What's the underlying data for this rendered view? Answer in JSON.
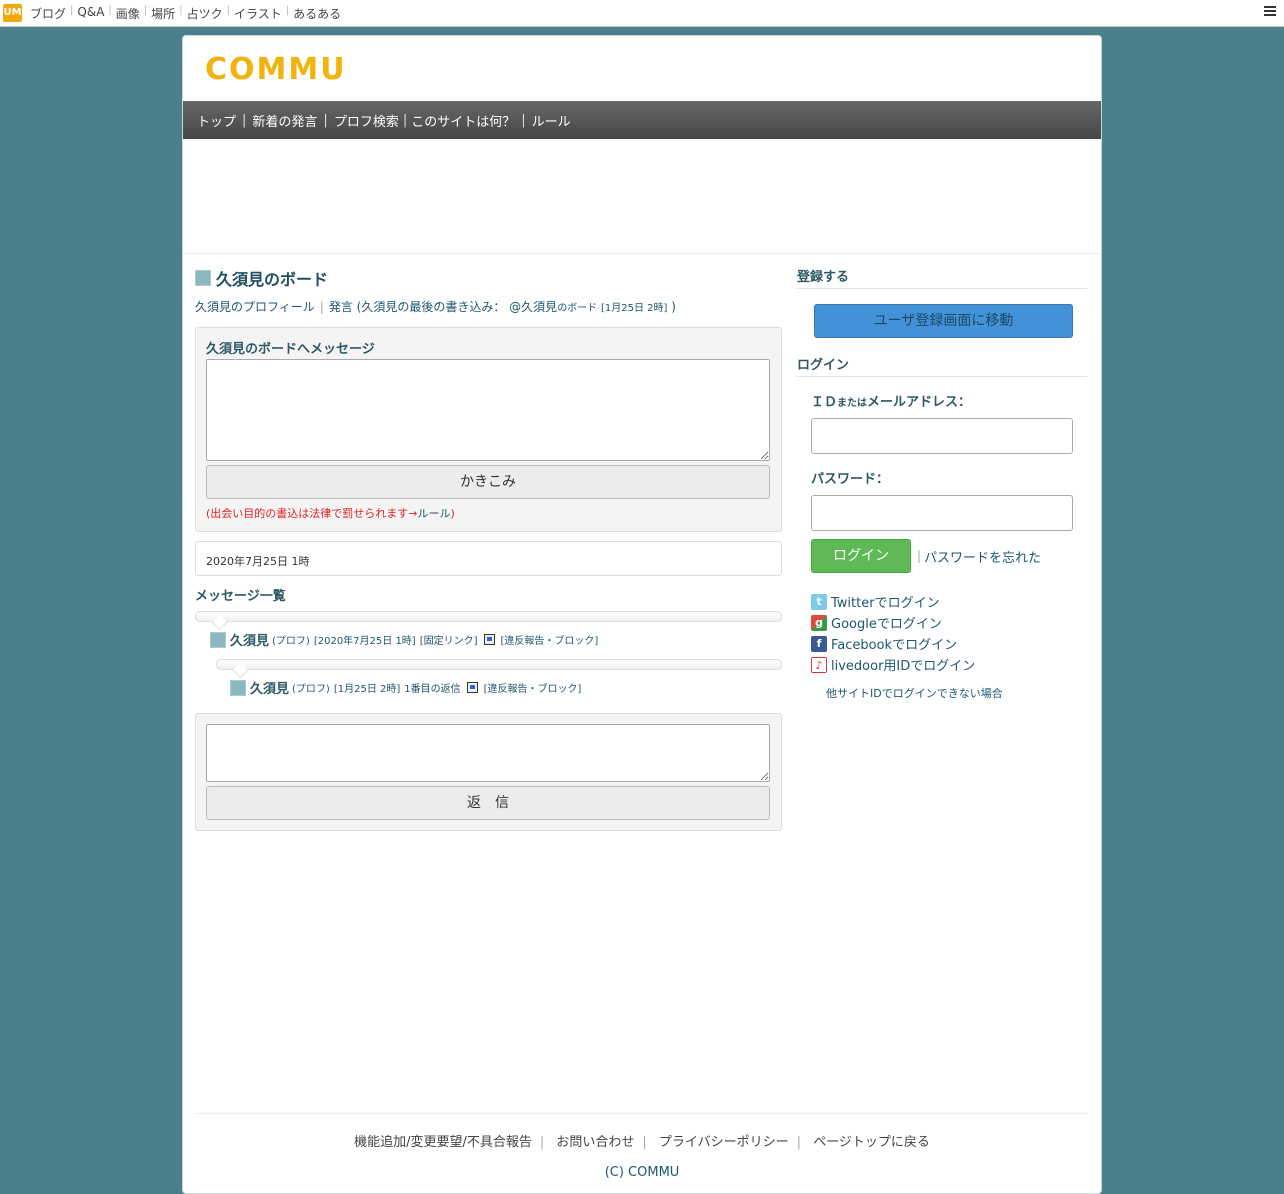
{
  "topbar": {
    "logo": "UM",
    "links": [
      "ブログ",
      "Q&A",
      "画像",
      "場所",
      "占ツク",
      "イラスト",
      "あるある"
    ]
  },
  "site": {
    "logo": "COMMU"
  },
  "nav": [
    "トップ",
    "新着の発言",
    "プロフ検索",
    "このサイトは何？",
    "ルール"
  ],
  "board": {
    "title": "久須見のボード",
    "profile_link": "久須見のプロフィール",
    "posts_link": "発言",
    "last_post_prefix": "(久須見の最後の書き込み：",
    "last_post_at": "@久須見",
    "last_post_board": "のボード",
    "last_post_time": "[1月25日 2時]",
    "last_post_close": ")"
  },
  "post_form": {
    "label": "久須見のボードへメッセージ",
    "submit": "かきこみ",
    "warning_text": "(出会い目的の書込は法律で罰せられます",
    "warning_arrow": "→",
    "warning_link": "ルール",
    "warning_close": ")"
  },
  "date_box": "2020年7月25日 1時",
  "messages_title": "メッセージ一覧",
  "messages": [
    {
      "name": "久須見",
      "prof": "(プロフ)",
      "time": "[2020年7月25日 1時]",
      "fixed_link": "[固定リンク]",
      "report": "[違反報告・ブロック]"
    },
    {
      "name": "久須見",
      "prof": "(プロフ)",
      "time": "[1月25日 2時]",
      "reply_no": "1番目の返信",
      "report": "[違反報告・ブロック]"
    }
  ],
  "reply_form": {
    "submit": "返　信"
  },
  "sidebar": {
    "register_heading": "登録する",
    "register_button": "ユーザ登録画面に移動",
    "login_heading": "ログイン",
    "id_label_a": "ＩＤ",
    "id_label_small": "または",
    "id_label_b": "メールアドレス：",
    "password_label": "パスワード：",
    "login_button": "ログイン",
    "forgot_password": "パスワードを忘れた",
    "social": [
      {
        "icon": "twitter-icon",
        "label": "Twitterでログイン"
      },
      {
        "icon": "google-icon",
        "label": "Googleでログイン"
      },
      {
        "icon": "facebook-icon",
        "label": "Facebookでログイン"
      },
      {
        "icon": "livedoor-icon",
        "label": "livedoor用IDでログイン"
      }
    ],
    "other_id": "他サイトIDでログインできない場合"
  },
  "footer": {
    "links": [
      "機能追加/変更要望/不具合報告",
      "お問い合わせ",
      "プライバシーポリシー",
      "ページトップに戻る"
    ],
    "copyright": "(C) COMMU"
  },
  "colors": {
    "background": "#4a808c",
    "logo": "#f2b30e",
    "nav": "#555555",
    "register_button": "#4391d6",
    "login_button": "#5fba55",
    "warning": "#e02020"
  }
}
